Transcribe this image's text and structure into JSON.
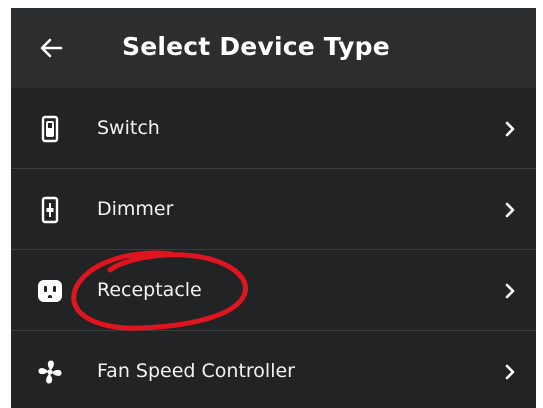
{
  "header": {
    "title": "Select Device Type",
    "back_icon": "arrow-left-icon"
  },
  "device_types": [
    {
      "label": "Switch",
      "icon": "switch-icon"
    },
    {
      "label": "Dimmer",
      "icon": "dimmer-icon"
    },
    {
      "label": "Receptacle",
      "icon": "receptacle-icon"
    },
    {
      "label": "Fan Speed Controller",
      "icon": "fan-icon"
    }
  ],
  "colors": {
    "background": "#222324",
    "header": "#2b2d2e",
    "divider": "#3a3c3d",
    "text": "#ffffff",
    "annotation": "#e0141e"
  }
}
